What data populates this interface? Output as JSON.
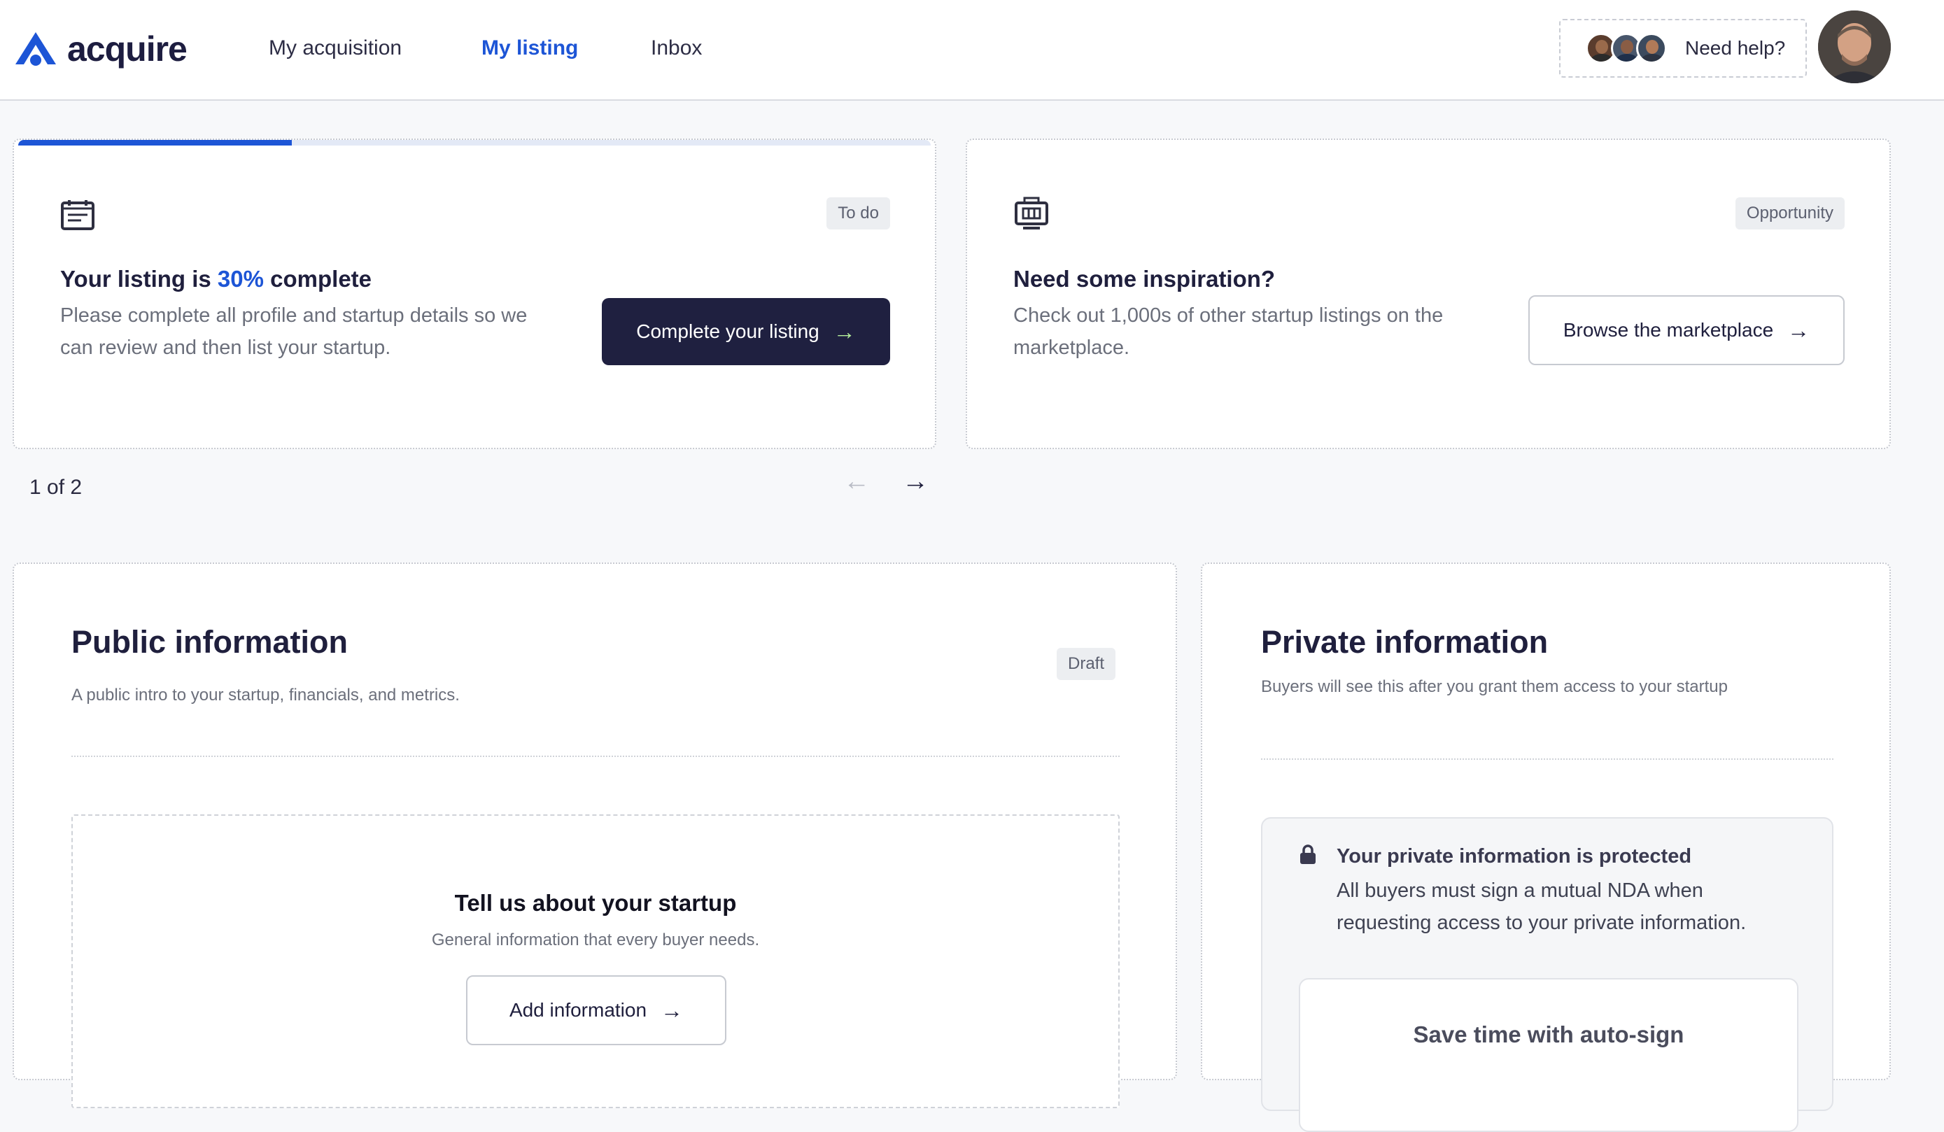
{
  "brand": {
    "name": "acquire",
    "accent": "#1d55d6",
    "dark": "#1f2040"
  },
  "nav": {
    "items": [
      {
        "label": "My acquisition"
      },
      {
        "label": "My listing",
        "active": true
      },
      {
        "label": "Inbox"
      }
    ]
  },
  "help": {
    "label": "Need help?",
    "avatar_count": 3
  },
  "task_card": {
    "icon": "listing-form-icon",
    "badge": "To do",
    "title_prefix": "Your listing is ",
    "percent": "30%",
    "title_suffix": " complete",
    "description": "Please complete all profile and startup details so we can review and then list your startup.",
    "button_label": "Complete your listing",
    "progress": 0.3
  },
  "inspiration_card": {
    "icon": "marketplace-icon",
    "badge": "Opportunity",
    "title": "Need some inspiration?",
    "description": "Check out 1,000s of other startup listings on the marketplace.",
    "button_label": "Browse the marketplace"
  },
  "pager": {
    "label": "1 of 2"
  },
  "public_info": {
    "title": "Public information",
    "description": "A public intro to your startup, financials, and metrics.",
    "badge": "Draft",
    "startup_box": {
      "title": "Tell us about your startup",
      "description": "General information that every buyer needs.",
      "button_label": "Add information"
    }
  },
  "private_info": {
    "title": "Private information",
    "description": "Buyers will see this after you grant them access to your startup",
    "protected": {
      "title": "Your private information is protected",
      "description": "All buyers must sign a mutual NDA when requesting access to your private information."
    },
    "autosign": {
      "title": "Save time with auto-sign"
    }
  }
}
